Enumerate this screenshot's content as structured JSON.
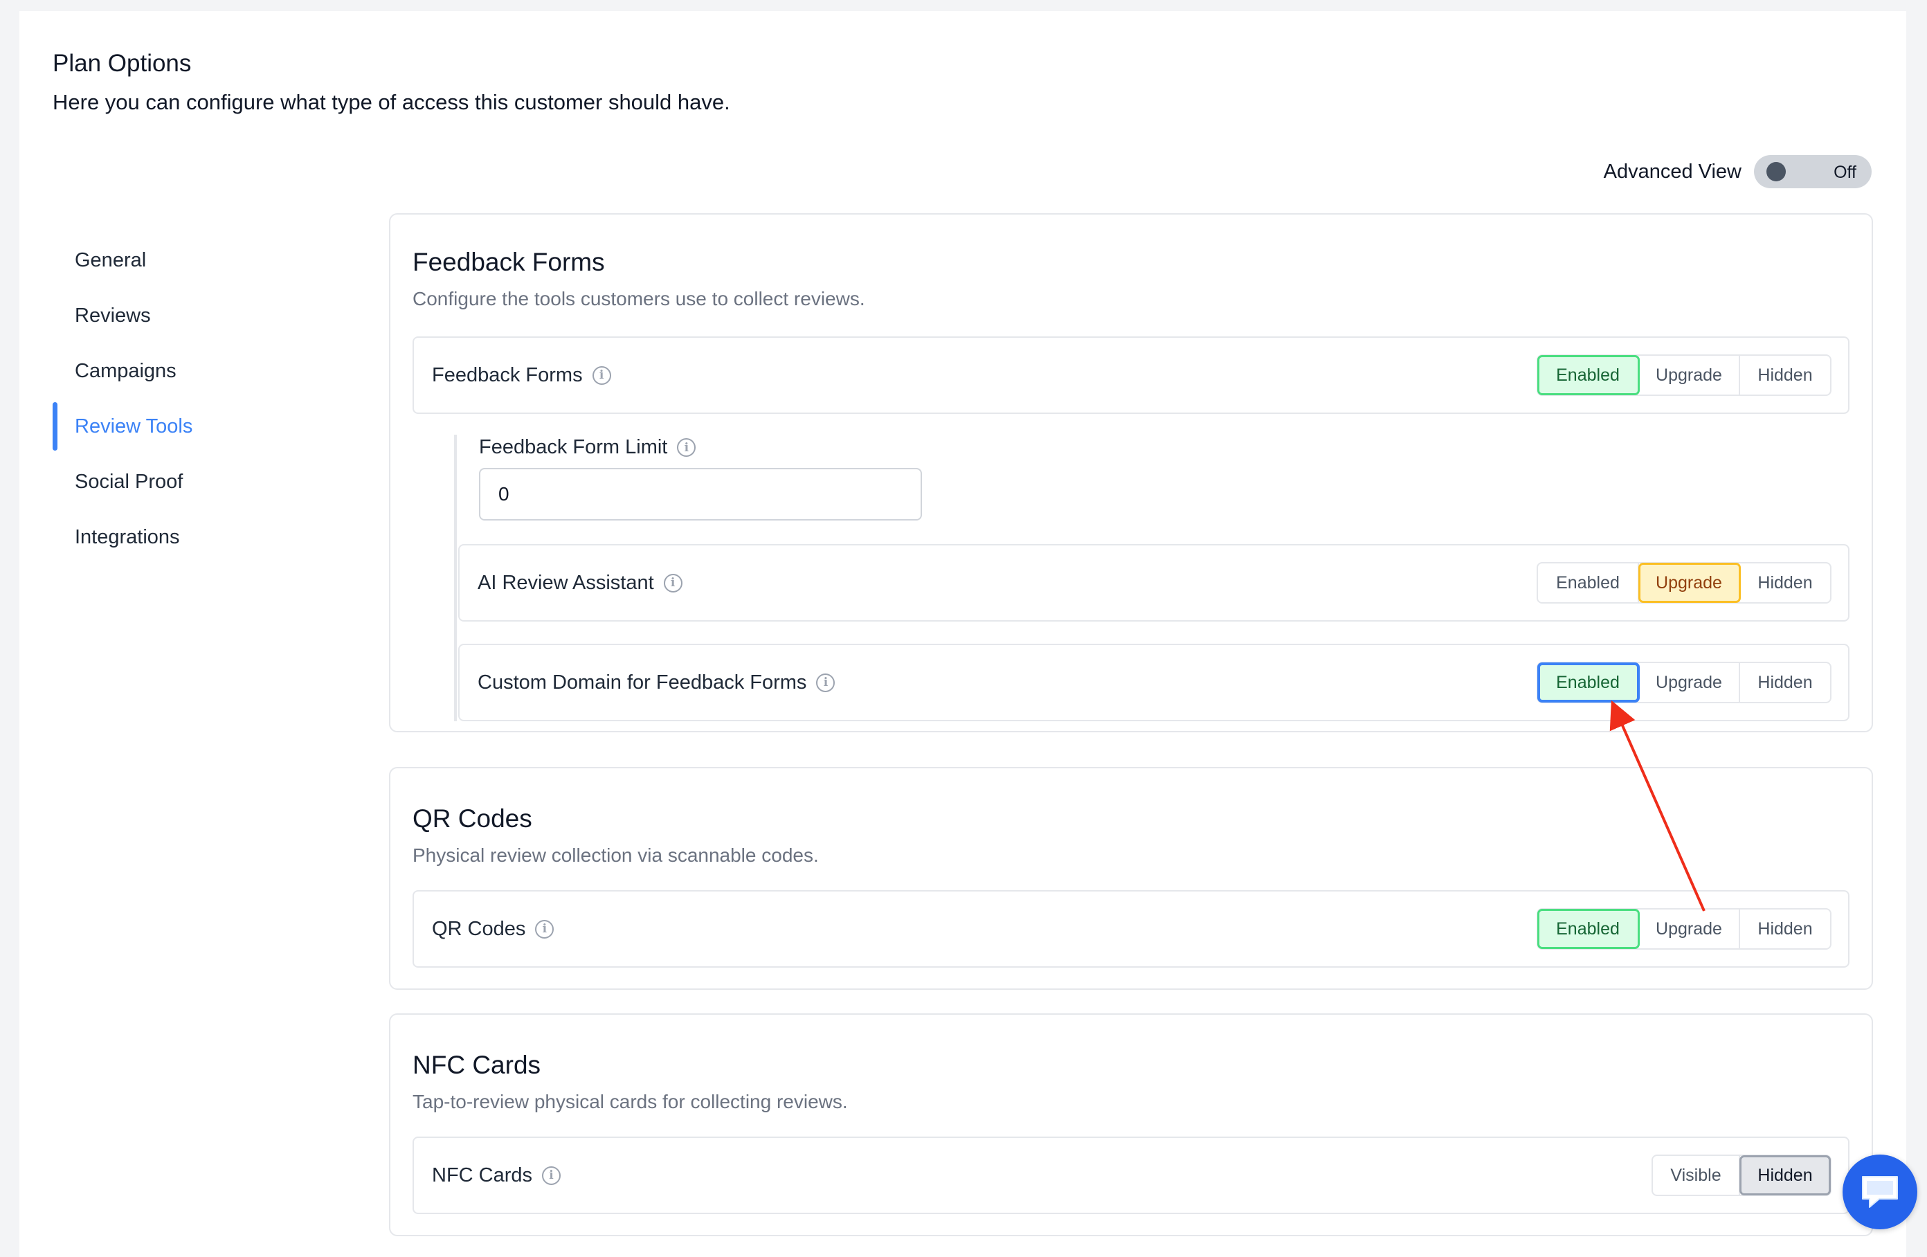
{
  "header": {
    "title": "Plan Options",
    "subtitle": "Here you can configure what type of access this customer should have."
  },
  "advanced_view": {
    "label": "Advanced View",
    "state": "Off"
  },
  "sidebar": {
    "items": [
      {
        "label": "General",
        "active": false
      },
      {
        "label": "Reviews",
        "active": false
      },
      {
        "label": "Campaigns",
        "active": false
      },
      {
        "label": "Review Tools",
        "active": true
      },
      {
        "label": "Social Proof",
        "active": false
      },
      {
        "label": "Integrations",
        "active": false
      }
    ]
  },
  "sections": {
    "feedback_forms": {
      "title": "Feedback Forms",
      "description": "Configure the tools customers use to collect reviews.",
      "row": {
        "label": "Feedback Forms",
        "options": [
          "Enabled",
          "Upgrade",
          "Hidden"
        ],
        "selected": "Enabled"
      },
      "limit": {
        "label": "Feedback Form Limit",
        "value": "0"
      },
      "ai_row": {
        "label": "AI Review Assistant",
        "options": [
          "Enabled",
          "Upgrade",
          "Hidden"
        ],
        "selected": "Upgrade"
      },
      "domain_row": {
        "label": "Custom Domain for Feedback Forms",
        "options": [
          "Enabled",
          "Upgrade",
          "Hidden"
        ],
        "selected": "Enabled"
      }
    },
    "qr_codes": {
      "title": "QR Codes",
      "description": "Physical review collection via scannable codes.",
      "row": {
        "label": "QR Codes",
        "options": [
          "Enabled",
          "Upgrade",
          "Hidden"
        ],
        "selected": "Enabled"
      }
    },
    "nfc_cards": {
      "title": "NFC Cards",
      "description": "Tap-to-review physical cards for collecting reviews.",
      "row": {
        "label": "NFC Cards",
        "options": [
          "Visible",
          "Hidden"
        ],
        "selected": "Hidden"
      }
    }
  },
  "colors": {
    "accent": "#3b82f6",
    "enabled_bg": "#dcfce7",
    "upgrade_bg": "#fef3c7",
    "annotation_arrow": "#ef2d1a",
    "chat_button": "#2563eb"
  },
  "icons": {
    "info": "info-icon",
    "chat": "chat-icon"
  }
}
